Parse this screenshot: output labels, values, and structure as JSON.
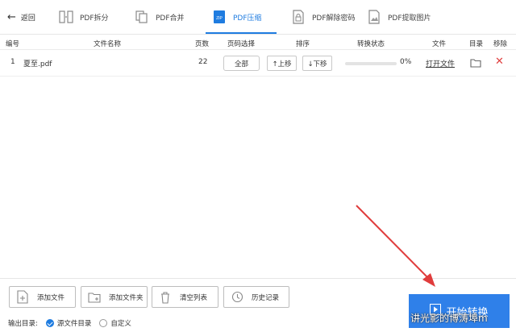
{
  "toolbar": {
    "back_label": "返回",
    "tabs": [
      {
        "label": "PDF拆分"
      },
      {
        "label": "PDF合并"
      },
      {
        "label": "PDF压缩"
      },
      {
        "label": "PDF解除密码"
      },
      {
        "label": "PDF提取图片"
      }
    ],
    "active_tab": "PDF压缩",
    "accent_color": "#1f7ce0"
  },
  "table": {
    "columns": [
      "编号",
      "文件名称",
      "页数",
      "页码选择",
      "排序",
      "转换状态",
      "文件",
      "目录",
      "移除"
    ],
    "rows": [
      {
        "index": "1",
        "filename": "夏至.pdf",
        "pages": "22",
        "page_select": "全部",
        "move_up": "↑上移",
        "move_down": "↓下移",
        "progress_percent": 0,
        "status_text": "0%",
        "open_file": "打开文件",
        "folder_icon": "folder-icon",
        "remove_icon": "close-icon"
      }
    ]
  },
  "bottom": {
    "buttons": [
      {
        "label": "添加文件",
        "icon": "add-file-icon"
      },
      {
        "label": "添加文件夹",
        "icon": "add-folder-icon"
      },
      {
        "label": "清空列表",
        "icon": "trash-icon"
      },
      {
        "label": "历史记录",
        "icon": "clock-icon"
      }
    ],
    "output_label": "输出目录:",
    "output_options": [
      {
        "label": "源文件目录",
        "selected": true
      },
      {
        "label": "自定义",
        "selected": false
      }
    ],
    "start_button": "开始转换",
    "watermark": "讲光影的博涛埠m"
  }
}
